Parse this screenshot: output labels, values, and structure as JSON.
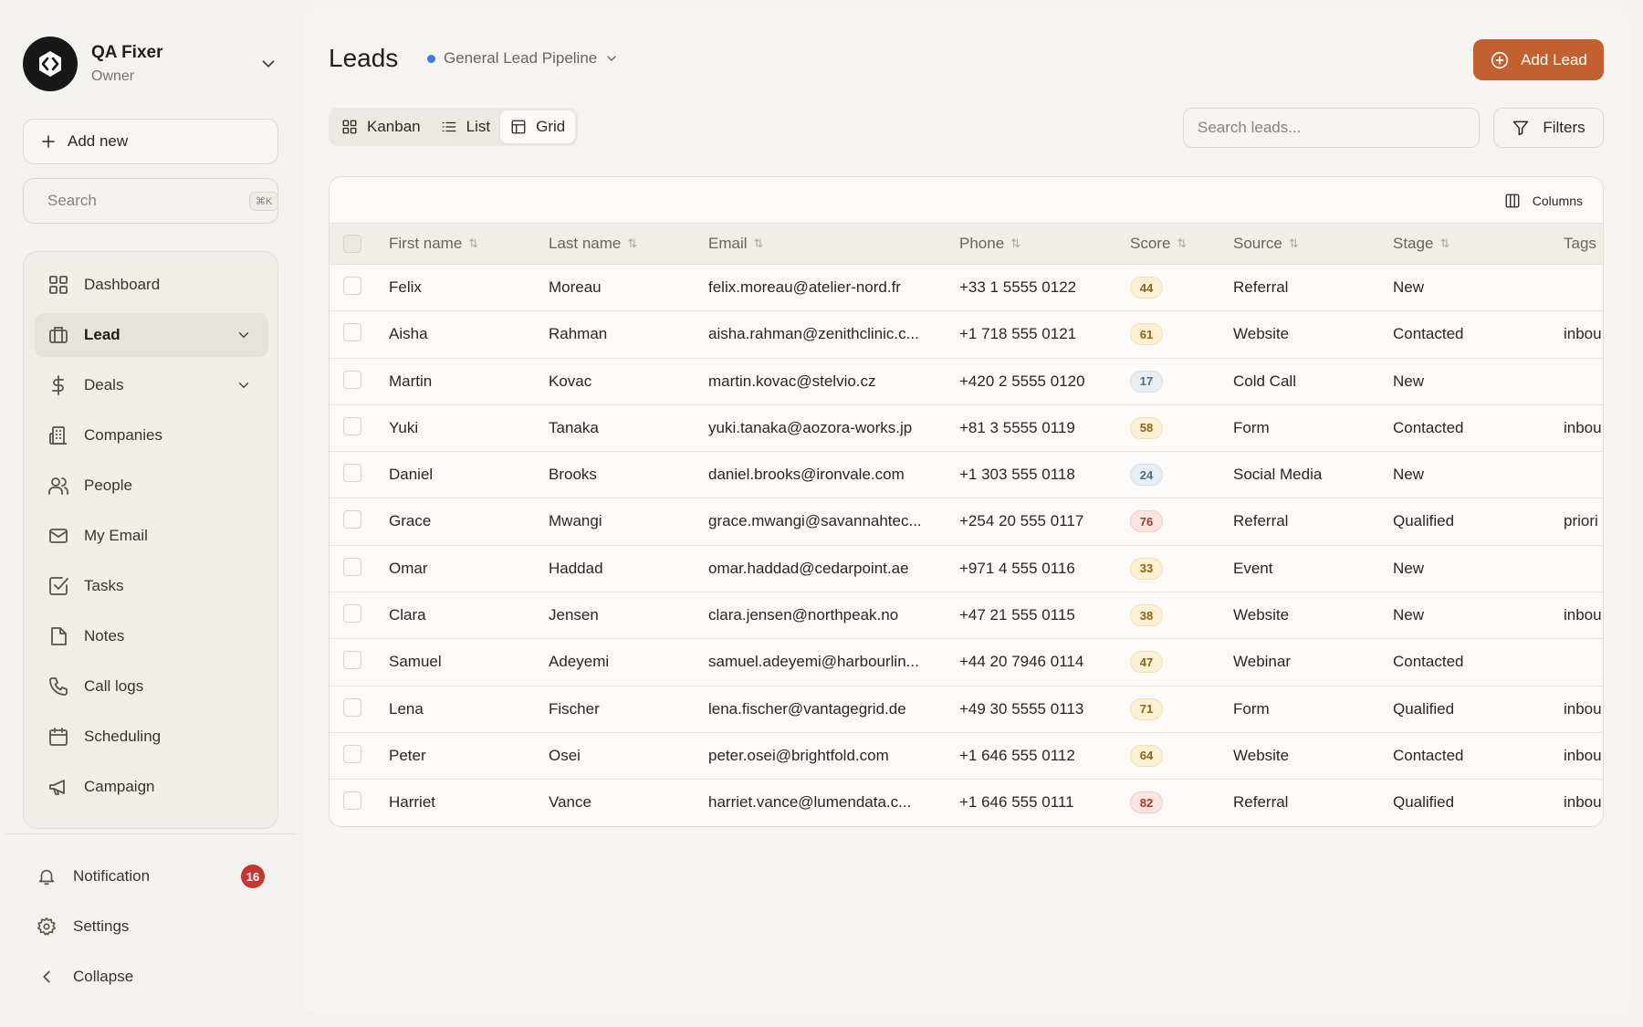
{
  "account": {
    "name": "QA Fixer",
    "role": "Owner"
  },
  "sidebar": {
    "add_new_label": "Add new",
    "search_placeholder": "Search",
    "search_shortcut": "⌘K",
    "items": [
      {
        "label": "Dashboard",
        "icon": "dashboard-icon"
      },
      {
        "label": "Lead",
        "icon": "lead-icon",
        "active": true,
        "expandable": true
      },
      {
        "label": "Deals",
        "icon": "dollar-icon",
        "expandable": true
      },
      {
        "label": "Companies",
        "icon": "building-icon"
      },
      {
        "label": "People",
        "icon": "people-icon"
      },
      {
        "label": "My Email",
        "icon": "mail-icon"
      },
      {
        "label": "Tasks",
        "icon": "checkbox-icon"
      },
      {
        "label": "Notes",
        "icon": "note-icon"
      },
      {
        "label": "Call logs",
        "icon": "phone-icon"
      },
      {
        "label": "Scheduling",
        "icon": "calendar-icon"
      },
      {
        "label": "Campaign",
        "icon": "megaphone-icon"
      }
    ],
    "bottom": {
      "notification_label": "Notification",
      "notification_count": "16",
      "settings_label": "Settings",
      "collapse_label": "Collapse"
    }
  },
  "header": {
    "title": "Leads",
    "pipeline": "General Lead Pipeline",
    "add_lead_label": "Add Lead"
  },
  "toolbar": {
    "views": [
      {
        "label": "Kanban",
        "icon": "kanban-icon"
      },
      {
        "label": "List",
        "icon": "list-icon"
      },
      {
        "label": "Grid",
        "icon": "grid-icon",
        "active": true
      }
    ],
    "search_placeholder": "Search leads...",
    "filters_label": "Filters",
    "columns_label": "Columns"
  },
  "table": {
    "headers": {
      "first_name": "First name",
      "last_name": "Last name",
      "email": "Email",
      "phone": "Phone",
      "score": "Score",
      "source": "Source",
      "stage": "Stage",
      "tags": "Tags"
    },
    "rows": [
      {
        "first_name": "Felix",
        "last_name": "Moreau",
        "email": "felix.moreau@atelier-nord.fr",
        "phone": "+33 1 5555 0122",
        "score": "44",
        "source": "Referral",
        "stage": "New",
        "tags": ""
      },
      {
        "first_name": "Aisha",
        "last_name": "Rahman",
        "email": "aisha.rahman@zenithclinic.c...",
        "phone": "+1 718 555 0121",
        "score": "61",
        "source": "Website",
        "stage": "Contacted",
        "tags": "inbou"
      },
      {
        "first_name": "Martin",
        "last_name": "Kovac",
        "email": "martin.kovac@stelvio.cz",
        "phone": "+420 2 5555 0120",
        "score": "17",
        "source": "Cold Call",
        "stage": "New",
        "tags": ""
      },
      {
        "first_name": "Yuki",
        "last_name": "Tanaka",
        "email": "yuki.tanaka@aozora-works.jp",
        "phone": "+81 3 5555 0119",
        "score": "58",
        "source": "Form",
        "stage": "Contacted",
        "tags": "inbou"
      },
      {
        "first_name": "Daniel",
        "last_name": "Brooks",
        "email": "daniel.brooks@ironvale.com",
        "phone": "+1 303 555 0118",
        "score": "24",
        "source": "Social Media",
        "stage": "New",
        "tags": ""
      },
      {
        "first_name": "Grace",
        "last_name": "Mwangi",
        "email": "grace.mwangi@savannahtec...",
        "phone": "+254 20 555 0117",
        "score": "76",
        "source": "Referral",
        "stage": "Qualified",
        "tags": "priori"
      },
      {
        "first_name": "Omar",
        "last_name": "Haddad",
        "email": "omar.haddad@cedarpoint.ae",
        "phone": "+971 4 555 0116",
        "score": "33",
        "source": "Event",
        "stage": "New",
        "tags": ""
      },
      {
        "first_name": "Clara",
        "last_name": "Jensen",
        "email": "clara.jensen@northpeak.no",
        "phone": "+47 21 555 0115",
        "score": "38",
        "source": "Website",
        "stage": "New",
        "tags": "inbou"
      },
      {
        "first_name": "Samuel",
        "last_name": "Adeyemi",
        "email": "samuel.adeyemi@harbourlin...",
        "phone": "+44 20 7946 0114",
        "score": "47",
        "source": "Webinar",
        "stage": "Contacted",
        "tags": ""
      },
      {
        "first_name": "Lena",
        "last_name": "Fischer",
        "email": "lena.fischer@vantagegrid.de",
        "phone": "+49 30 5555 0113",
        "score": "71",
        "source": "Form",
        "stage": "Qualified",
        "tags": "inbou"
      },
      {
        "first_name": "Peter",
        "last_name": "Osei",
        "email": "peter.osei@brightfold.com",
        "phone": "+1 646 555 0112",
        "score": "64",
        "source": "Website",
        "stage": "Contacted",
        "tags": "inbou"
      },
      {
        "first_name": "Harriet",
        "last_name": "Vance",
        "email": "harriet.vance@lumendata.c...",
        "phone": "+1 646 555 0111",
        "score": "82",
        "source": "Referral",
        "stage": "Qualified",
        "tags": "inbou"
      }
    ]
  },
  "colors": {
    "accent": "#c2602f",
    "pipeline_dot": "#3b7be0",
    "badge": "#c4372f"
  }
}
